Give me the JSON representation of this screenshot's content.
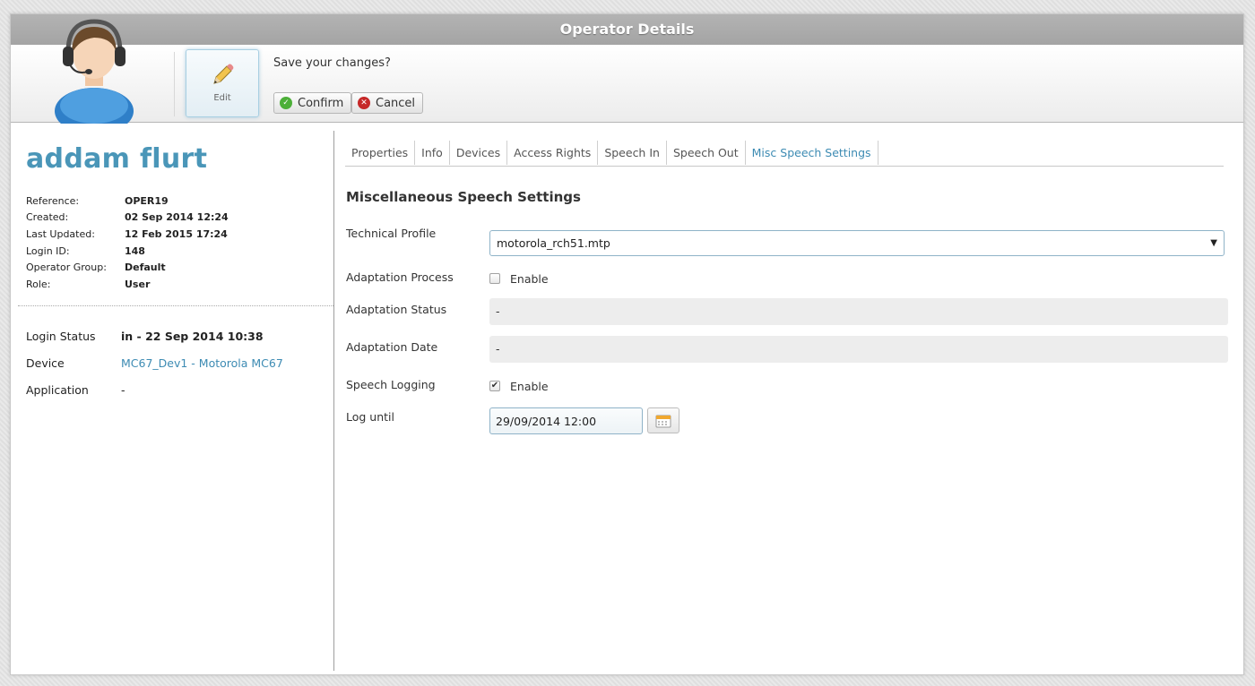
{
  "window": {
    "title": "Operator Details"
  },
  "toolbar": {
    "edit_label": "Edit",
    "save_prompt": "Save your changes?",
    "confirm_label": "Confirm",
    "cancel_label": "Cancel"
  },
  "operator": {
    "name": "addam flurt",
    "meta": [
      {
        "key": "Reference:",
        "value": "OPER19"
      },
      {
        "key": "Created:",
        "value": "02 Sep 2014 12:24"
      },
      {
        "key": "Last Updated:",
        "value": "12 Feb 2015 17:24"
      },
      {
        "key": "Login ID:",
        "value": "148"
      },
      {
        "key": "Operator Group:",
        "value": "Default"
      },
      {
        "key": "Role:",
        "value": "User"
      }
    ],
    "status": {
      "login_status_label": "Login Status",
      "login_status_value": "in - 22 Sep 2014 10:38",
      "device_label": "Device",
      "device_value": "MC67_Dev1 - Motorola MC67",
      "application_label": "Application",
      "application_value": "-"
    }
  },
  "tabs": [
    {
      "label": "Properties",
      "active": false
    },
    {
      "label": "Info",
      "active": false
    },
    {
      "label": "Devices",
      "active": false
    },
    {
      "label": "Access Rights",
      "active": false
    },
    {
      "label": "Speech In",
      "active": false
    },
    {
      "label": "Speech Out",
      "active": false
    },
    {
      "label": "Misc Speech Settings",
      "active": true
    }
  ],
  "form": {
    "section_title": "Miscellaneous Speech Settings",
    "technical_profile_label": "Technical Profile",
    "technical_profile_value": "motorola_rch51.mtp",
    "adaptation_process_label": "Adaptation Process",
    "adaptation_process_enable": "Enable",
    "adaptation_process_checked": false,
    "adaptation_status_label": "Adaptation Status",
    "adaptation_status_value": "-",
    "adaptation_date_label": "Adaptation Date",
    "adaptation_date_value": "-",
    "speech_logging_label": "Speech Logging",
    "speech_logging_enable": "Enable",
    "speech_logging_checked": true,
    "log_until_label": "Log until",
    "log_until_value": "29/09/2014 12:00"
  },
  "colors": {
    "accent": "#4a96b8",
    "link": "#3d8bb3",
    "titlebar": "#a9a9a9",
    "confirm_icon": "#4caf38",
    "cancel_icon": "#c62828"
  },
  "icons": {
    "avatar": "operator-headset-avatar",
    "edit": "pencil-icon",
    "confirm": "check-circle-icon",
    "cancel": "x-circle-icon",
    "select": "caret-down-icon",
    "calendar": "calendar-icon"
  }
}
